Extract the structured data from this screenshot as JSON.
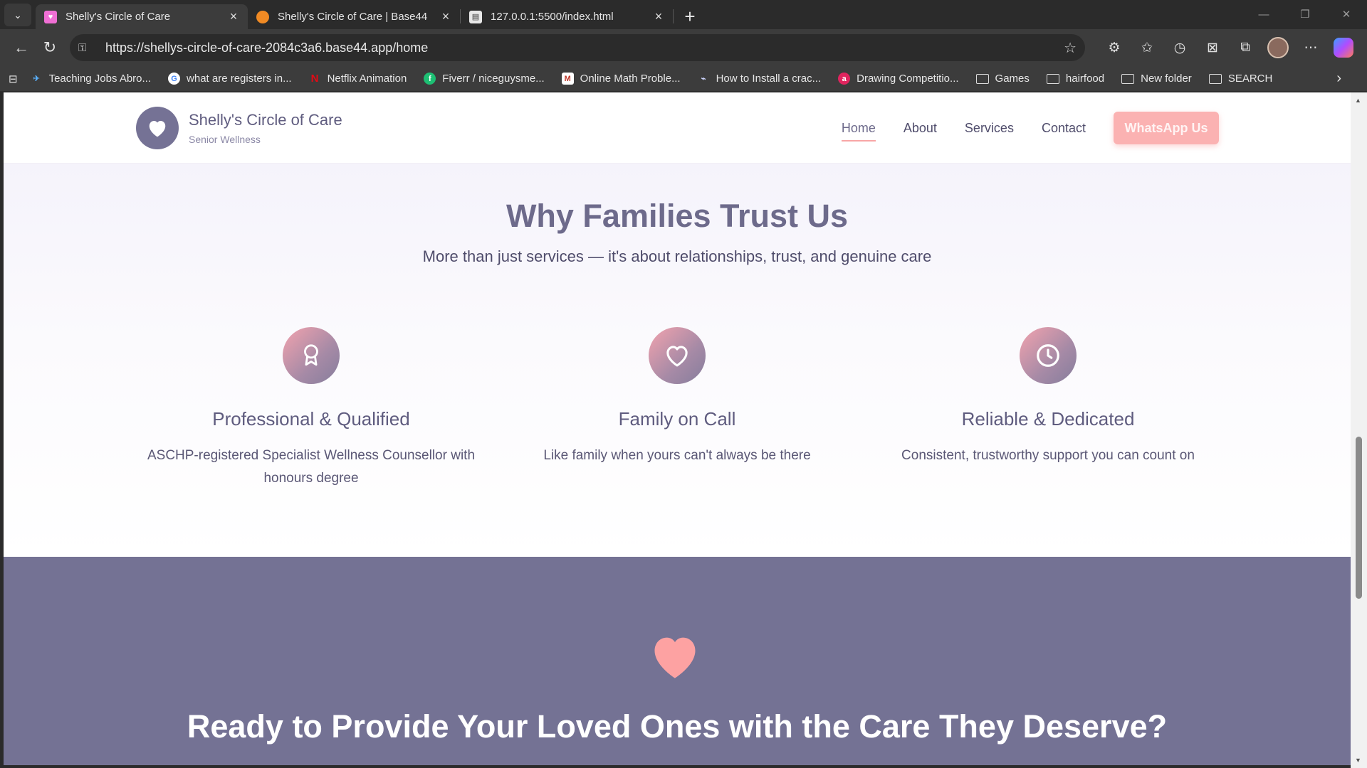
{
  "browser": {
    "tabs": [
      {
        "title": "Shelly's Circle of Care",
        "active": true,
        "favicon": "heart-favicon"
      },
      {
        "title": "Shelly's Circle of Care | Base44",
        "active": false,
        "favicon": "base44-favicon"
      },
      {
        "title": "127.0.0.1:5500/index.html",
        "active": false,
        "favicon": "file-favicon"
      }
    ],
    "url": "https://shellys-circle-of-care-2084c3a6.base44.app/home",
    "bookmarks": [
      {
        "label": "Teaching Jobs Abro...",
        "icon": "plane-icon"
      },
      {
        "label": "what are registers in...",
        "icon": "google-icon"
      },
      {
        "label": "Netflix Animation",
        "icon": "netflix-icon"
      },
      {
        "label": "Fiverr / niceguysme...",
        "icon": "fiverr-icon"
      },
      {
        "label": "Online Math Proble...",
        "icon": "math-icon"
      },
      {
        "label": "How to Install a crac...",
        "icon": "link-icon"
      },
      {
        "label": "Drawing Competitio...",
        "icon": "drawing-icon"
      },
      {
        "label": "Games",
        "icon": "folder-icon"
      },
      {
        "label": "hairfood",
        "icon": "folder-icon"
      },
      {
        "label": "New folder",
        "icon": "folder-icon"
      },
      {
        "label": "SEARCH",
        "icon": "folder-icon"
      }
    ]
  },
  "site": {
    "brand_name": "Shelly's Circle of Care",
    "brand_sub": "Senior Wellness",
    "nav": [
      "Home",
      "About",
      "Services",
      "Contact"
    ],
    "cta_button": "WhatsApp Us",
    "colors": {
      "primary": "#757295",
      "accent": "#fbb2b2",
      "text": "#5f5c7f"
    }
  },
  "trust": {
    "title": "Why Families Trust Us",
    "lead": "More than just services — it's about relationships, trust, and genuine care",
    "features": [
      {
        "icon": "award-icon",
        "title": "Professional & Qualified",
        "text": "ASCHP-registered Specialist Wellness Counsellor with honours degree"
      },
      {
        "icon": "heart-icon",
        "title": "Family on Call",
        "text": "Like family when yours can't always be there"
      },
      {
        "icon": "clock-icon",
        "title": "Reliable & Dedicated",
        "text": "Consistent, trustworthy support you can count on"
      }
    ]
  },
  "cta": {
    "title": "Ready to Provide Your Loved Ones with the Care They Deserve?"
  }
}
